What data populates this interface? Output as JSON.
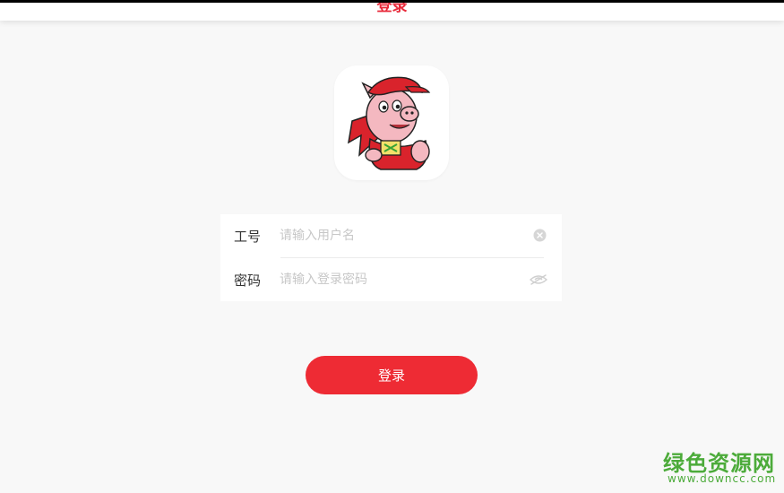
{
  "header": {
    "title": "登录"
  },
  "logo": {
    "name": "pig-mascot-logo"
  },
  "form": {
    "username": {
      "label": "工号",
      "placeholder": "请输入用户名",
      "value": "",
      "action_icon": "clear-icon"
    },
    "password": {
      "label": "密码",
      "placeholder": "请输入登录密码",
      "value": "",
      "action_icon": "eye-closed-icon"
    }
  },
  "login_button": {
    "label": "登录"
  },
  "watermark": {
    "title": "绿色资源网",
    "url": "www.downcc.com"
  },
  "colors": {
    "accent": "#ee2b34",
    "header_title": "#e8293a",
    "background": "#f8f8f8",
    "watermark": "#4cab3a"
  }
}
